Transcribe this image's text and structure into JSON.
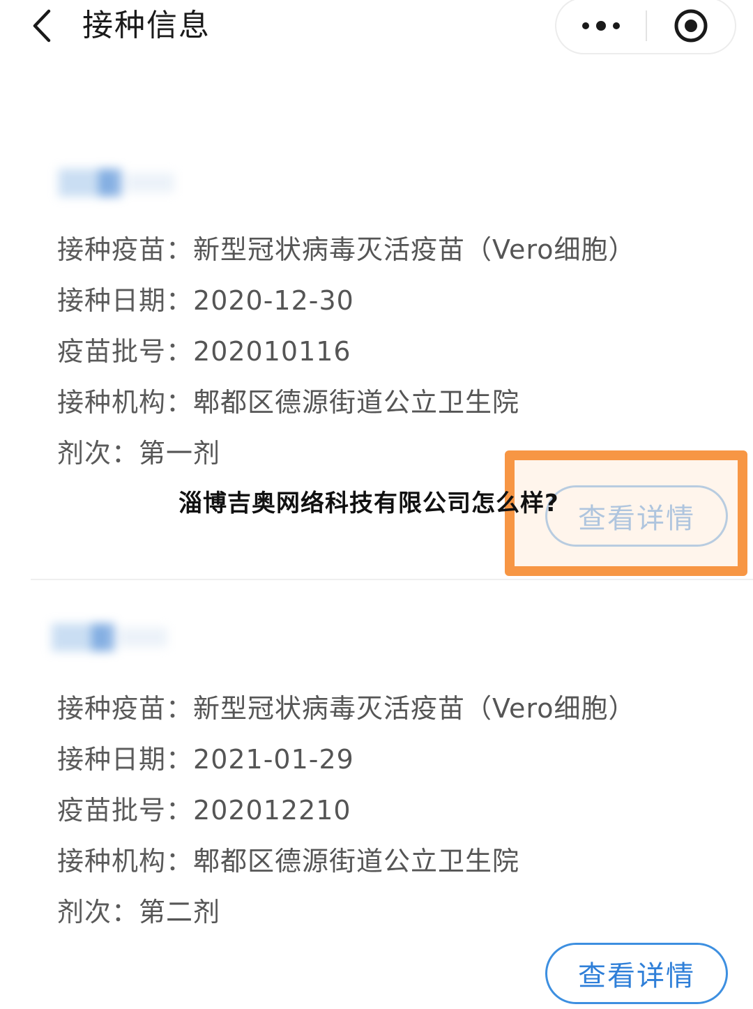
{
  "header": {
    "title": "接种信息",
    "back_icon": "chevron-left-icon",
    "more_icon": "more-dots-icon",
    "close_icon": "target-close-icon"
  },
  "records": [
    {
      "vaccine_label": "接种疫苗：",
      "vaccine_value": "新型冠状病毒灭活疫苗（Vero细胞）",
      "date_label": "接种日期：",
      "date_value": "2020-12-30",
      "batch_label": "疫苗批号：",
      "batch_value": "202010116",
      "site_label": "接种机构：",
      "site_value": "郫都区德源街道公立卫生院",
      "dose_label": "剂次：",
      "dose_value": "第一剂",
      "detail_button": "查看详情"
    },
    {
      "vaccine_label": "接种疫苗：",
      "vaccine_value": "新型冠状病毒灭活疫苗（Vero细胞）",
      "date_label": "接种日期：",
      "date_value": "2021-01-29",
      "batch_label": "疫苗批号：",
      "batch_value": "202012210",
      "site_label": "接种机构：",
      "site_value": "郫都区德源街道公立卫生院",
      "dose_label": "剂次：",
      "dose_value": "第二剂",
      "detail_button": "查看详情"
    }
  ],
  "overlay": {
    "caption": "淄博吉奥网络科技有限公司怎么样?",
    "highlight_color": "#f7903a"
  },
  "colors": {
    "accent": "#3d8fe0",
    "text": "#555555",
    "title": "#1a1a1a"
  }
}
